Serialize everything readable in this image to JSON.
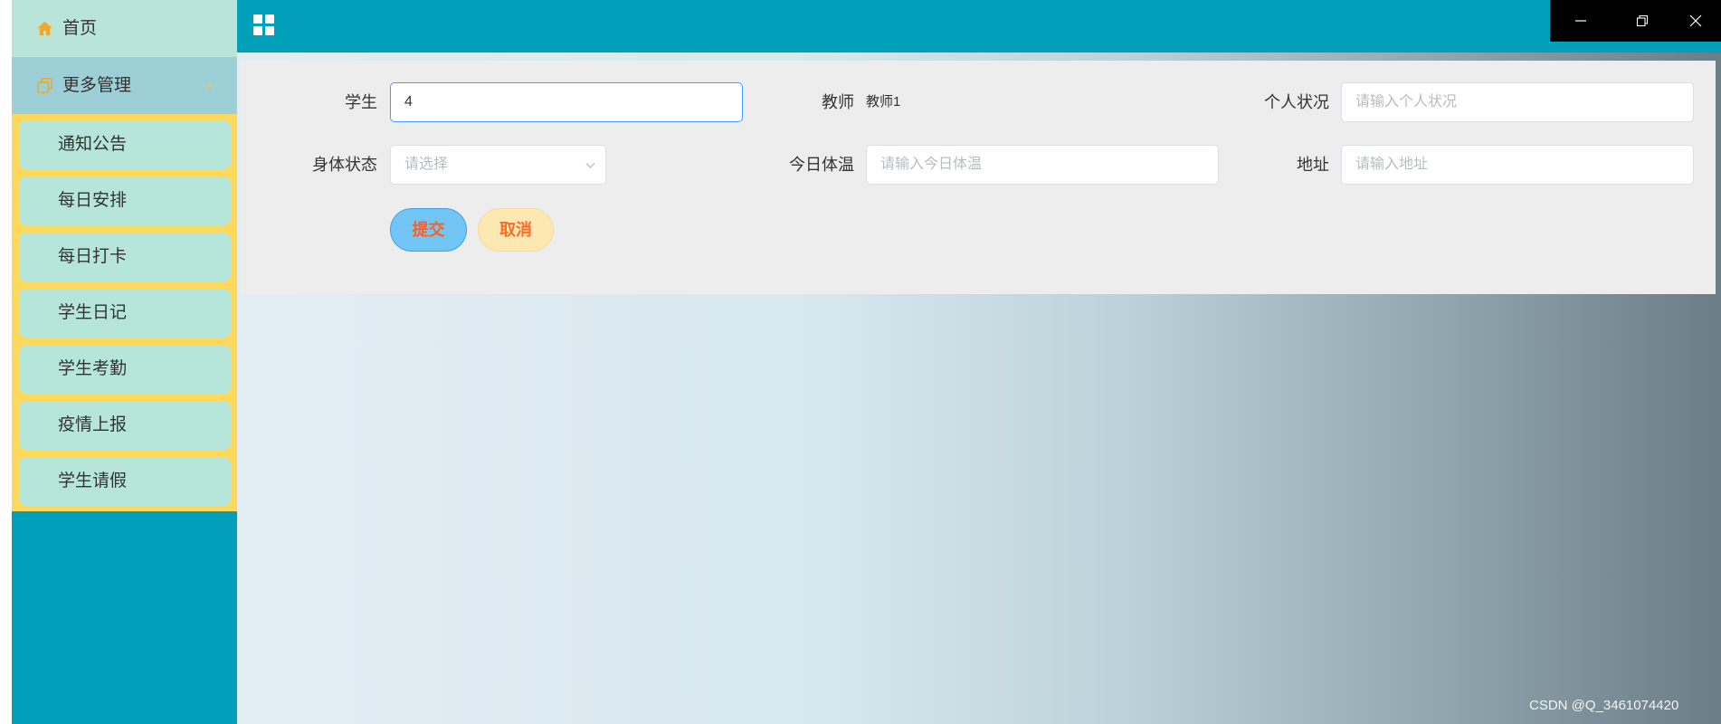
{
  "sidebar": {
    "home": {
      "label": "首页",
      "icon": "home-icon"
    },
    "group": {
      "label": "更多管理",
      "icon": "copy-icon",
      "expanded": true
    },
    "submenu": [
      {
        "label": "通知公告"
      },
      {
        "label": "每日安排"
      },
      {
        "label": "每日打卡"
      },
      {
        "label": "学生日记"
      },
      {
        "label": "学生考勤"
      },
      {
        "label": "疫情上报"
      },
      {
        "label": "学生请假"
      }
    ]
  },
  "header": {
    "menu_icon": "grid-icon"
  },
  "window_controls": {
    "minimize": "minimize-icon",
    "restore": "restore-icon",
    "close": "close-icon"
  },
  "form": {
    "student": {
      "label": "学生",
      "value": "4"
    },
    "teacher": {
      "label": "教师",
      "value": "教师1"
    },
    "personal_status": {
      "label": "个人状况",
      "placeholder": "请输入个人状况"
    },
    "health_status": {
      "label": "身体状态",
      "placeholder": "请选择"
    },
    "temperature": {
      "label": "今日体温",
      "placeholder": "请输入今日体温"
    },
    "address": {
      "label": "地址",
      "placeholder": "请输入地址"
    },
    "submit_label": "提交",
    "cancel_label": "取消"
  },
  "footer": {
    "watermark": "CSDN @Q_3461074420"
  },
  "colors": {
    "sidebar": "#009fba",
    "header": "#009fba",
    "submenu_bg": "#fed85a",
    "submenu_item": "#b6e6d9",
    "icon_accent": "#f5a623",
    "focus_border": "#409eff",
    "button_text": "#ff5e1f"
  }
}
